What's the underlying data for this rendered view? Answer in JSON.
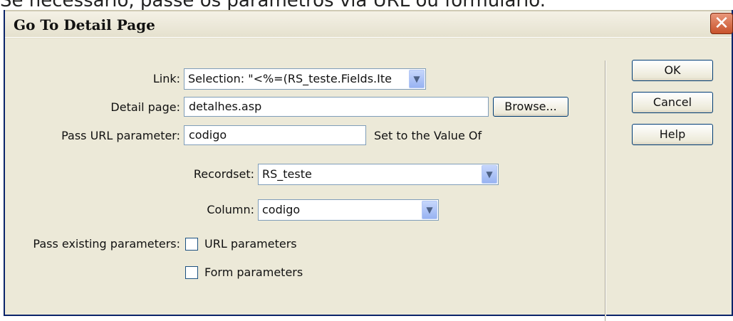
{
  "caption": "Se necessário, passe os parâmetros via URL ou formulário.",
  "window": {
    "title": "Go To Detail Page",
    "close_glyph": "✕"
  },
  "form": {
    "link_label": "Link:",
    "link_value": "Selection: \"<%=(RS_teste.Fields.Ite",
    "detail_page_label": "Detail page:",
    "detail_page_value": "detalhes.asp",
    "browse_label": "Browse...",
    "pass_url_label": "Pass URL parameter:",
    "pass_url_value": "codigo",
    "set_to_label": "Set to the Value Of",
    "recordset_label": "Recordset:",
    "recordset_value": "RS_teste",
    "column_label": "Column:",
    "column_value": "codigo",
    "pass_existing_label": "Pass existing parameters:",
    "url_params_label": "URL parameters",
    "url_params_checked": false,
    "form_params_label": "Form parameters",
    "form_params_checked": false
  },
  "buttons": {
    "ok": "OK",
    "cancel": "Cancel",
    "help": "Help"
  },
  "icons": {
    "dropdown_arrow": "chevron-down-icon",
    "close": "close-icon"
  }
}
